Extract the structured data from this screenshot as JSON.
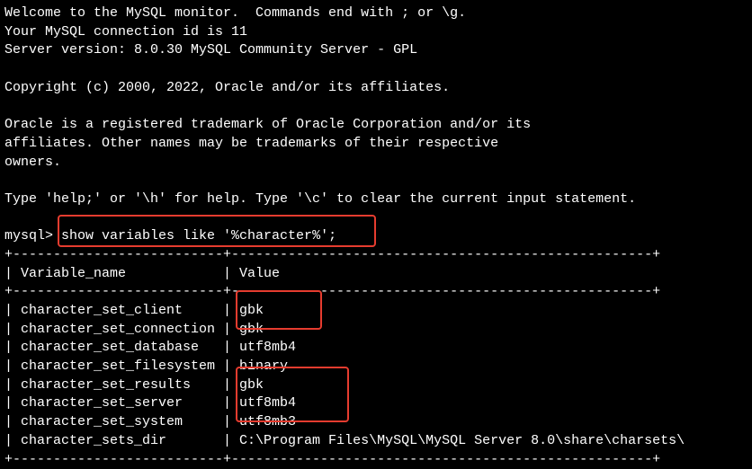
{
  "welcome": {
    "line1": "Welcome to the MySQL monitor.  Commands end with ; or \\g.",
    "line2": "Your MySQL connection id is 11",
    "line3": "Server version: 8.0.30 MySQL Community Server - GPL",
    "copyright": "Copyright (c) 2000, 2022, Oracle and/or its affiliates.",
    "trademark1": "Oracle is a registered trademark of Oracle Corporation and/or its",
    "trademark2": "affiliates. Other names may be trademarks of their respective",
    "trademark3": "owners.",
    "help": "Type 'help;' or '\\h' for help. Type '\\c' to clear the current input statement."
  },
  "prompt": {
    "label": "mysql>",
    "command": " show variables like '%character%';"
  },
  "table": {
    "border_top": "+--------------------------+----------------------------------------------------+",
    "header": "| Variable_name            | Value",
    "border_mid": "+--------------------------+----------------------------------------------------+",
    "rows": [
      "| character_set_client     | gbk",
      "| character_set_connection | gbk",
      "| character_set_database   | utf8mb4",
      "| character_set_filesystem | binary",
      "| character_set_results    | gbk",
      "| character_set_server     | utf8mb4",
      "| character_set_system     | utf8mb3",
      "| character_sets_dir       | C:\\Program Files\\MySQL\\MySQL Server 8.0\\share\\charsets\\"
    ],
    "border_bot": "+--------------------------+----------------------------------------------------+"
  },
  "chart_data": {
    "type": "table",
    "title": "MySQL character set variables",
    "columns": [
      "Variable_name",
      "Value"
    ],
    "rows": [
      [
        "character_set_client",
        "gbk"
      ],
      [
        "character_set_connection",
        "gbk"
      ],
      [
        "character_set_database",
        "utf8mb4"
      ],
      [
        "character_set_filesystem",
        "binary"
      ],
      [
        "character_set_results",
        "gbk"
      ],
      [
        "character_set_server",
        "utf8mb4"
      ],
      [
        "character_set_system",
        "utf8mb3"
      ],
      [
        "character_sets_dir",
        "C:\\Program Files\\MySQL\\MySQL Server 8.0\\share\\charsets\\"
      ]
    ]
  }
}
